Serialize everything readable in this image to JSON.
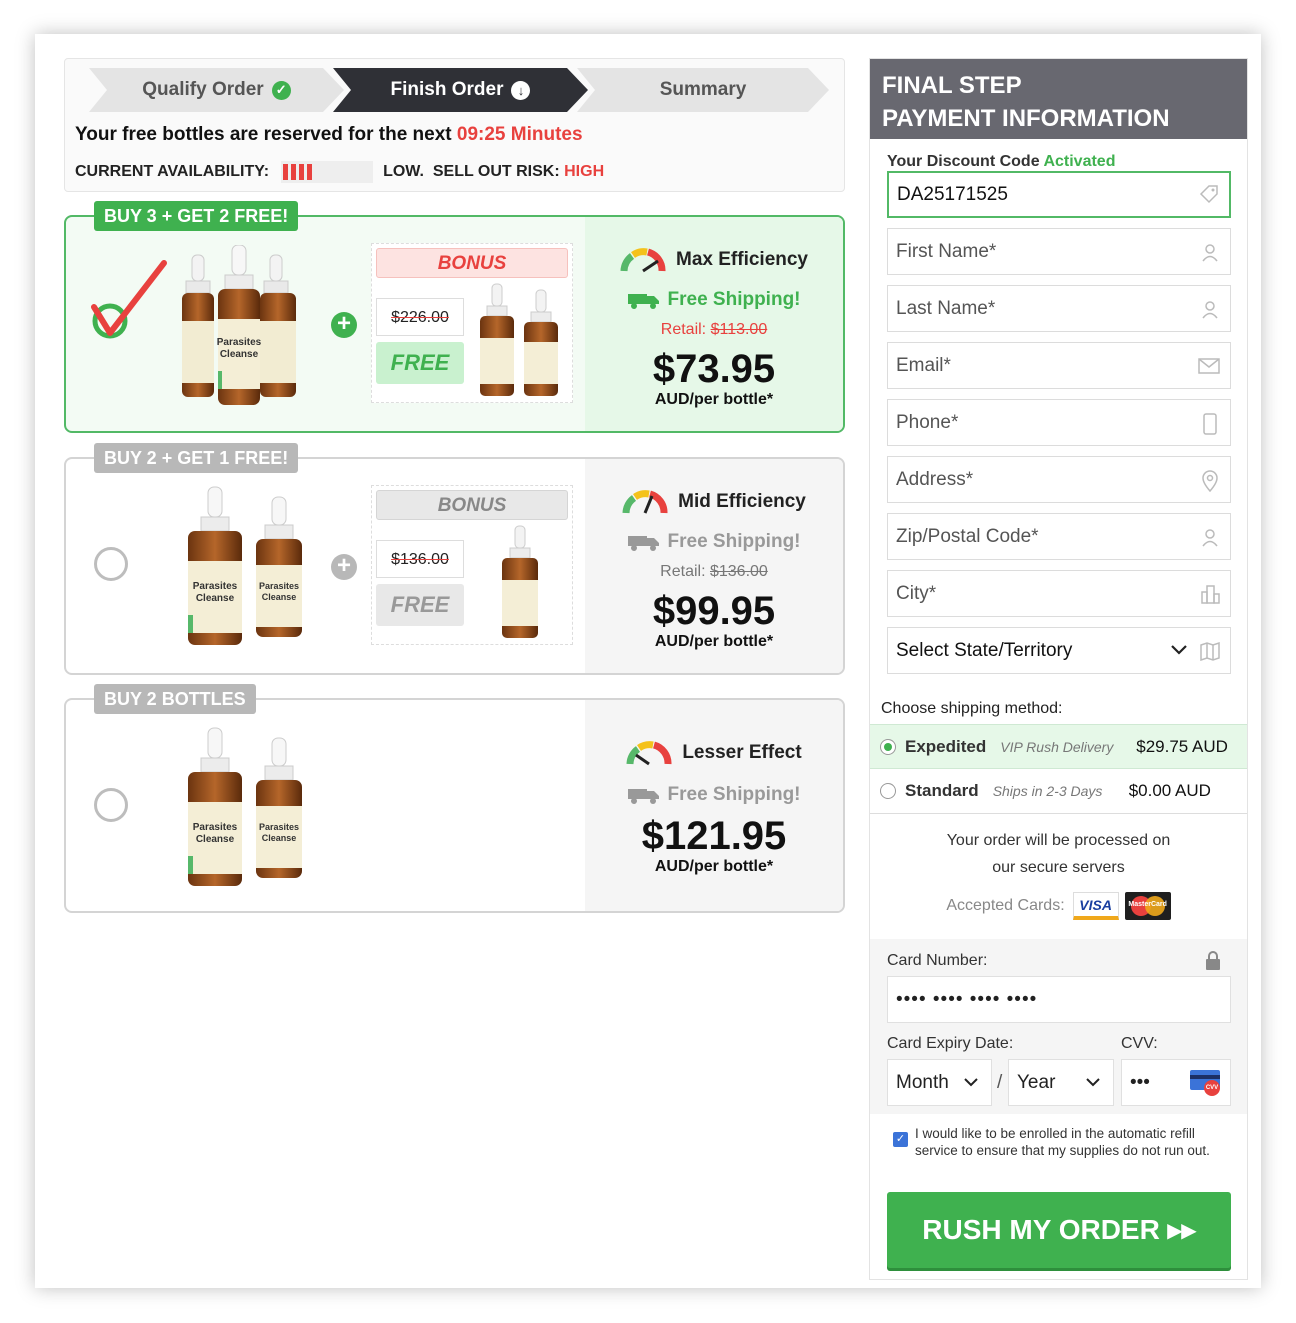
{
  "steps": [
    {
      "label": "Qualify Order",
      "icon": "check-circle-icon"
    },
    {
      "label": "Finish Order",
      "icon": "arrow-down-circle-icon"
    },
    {
      "label": "Summary",
      "icon": ""
    }
  ],
  "reserve": {
    "text": "Your free bottles are reserved for the next",
    "timer": "09:25 Minutes"
  },
  "availability": {
    "label": "CURRENT AVAILABILITY:",
    "level_text": "LOW.",
    "risk_label": "SELL OUT RISK:",
    "risk_value": "HIGH",
    "level_fraction": 0.3
  },
  "offers": [
    {
      "tag": "BUY 3 + GET 2 FREE!",
      "selected": true,
      "bonus_label": "BONUS",
      "old_price": "$226.00",
      "free_label": "FREE",
      "efficiency": "Max Efficiency",
      "shipping": "Free Shipping!",
      "retail_label": "Retail:",
      "retail_value": "$113.00",
      "price": "$73.95",
      "per": "AUD/per bottle*"
    },
    {
      "tag": "BUY 2 + GET 1 FREE!",
      "selected": false,
      "bonus_label": "BONUS",
      "old_price": "$136.00",
      "free_label": "FREE",
      "efficiency": "Mid Efficiency",
      "shipping": "Free Shipping!",
      "retail_label": "Retail:",
      "retail_value": "$136.00",
      "price": "$99.95",
      "per": "AUD/per bottle*"
    },
    {
      "tag": "BUY 2 BOTTLES",
      "selected": false,
      "efficiency": "Lesser Effect",
      "shipping": "Free Shipping!",
      "price": "$121.95",
      "per": "AUD/per bottle*"
    }
  ],
  "product_label": {
    "line1": "Parasites",
    "line2": "Cleanse"
  },
  "panel": {
    "title_line1": "FINAL STEP",
    "title_line2": "PAYMENT INFORMATION",
    "discount_label": "Your Discount Code",
    "discount_status": "Activated",
    "discount_code": "DA25171525",
    "fields": {
      "first_name": "First Name*",
      "last_name": "Last Name*",
      "email": "Email*",
      "phone": "Phone*",
      "address": "Address*",
      "zip": "Zip/Postal Code*",
      "city": "City*",
      "state": "Select State/Territory"
    },
    "shipping_label": "Choose shipping method:",
    "shipping_methods": [
      {
        "name": "Expedited",
        "desc": "VIP Rush Delivery",
        "price": "$29.75 AUD",
        "selected": true
      },
      {
        "name": "Standard",
        "desc": "Ships in 2-3 Days",
        "price": "$0.00 AUD",
        "selected": false
      }
    ],
    "secure_line1": "Your order will be processed on",
    "secure_line2": "our secure servers",
    "accepted_cards": "Accepted Cards:",
    "visa": "VISA",
    "mastercard": "MasterCard",
    "card_number_label": "Card Number:",
    "card_number_placeholder": "•••• •••• •••• ••••",
    "expiry_label": "Card Expiry Date:",
    "cvv_label": "CVV:",
    "month": "Month",
    "slash": "/",
    "year": "Year",
    "cvv_placeholder": "•••",
    "cvv_badge": "CVV",
    "refill_text": "I would like to be enrolled in the automatic refill service to ensure that my supplies do not run out.",
    "refill_checked": true,
    "cta": "RUSH MY ORDER ▸▸"
  },
  "colors": {
    "green": "#3fb14f",
    "red": "#e8413e",
    "dark_step": "#2f3036",
    "header": "#686870"
  }
}
